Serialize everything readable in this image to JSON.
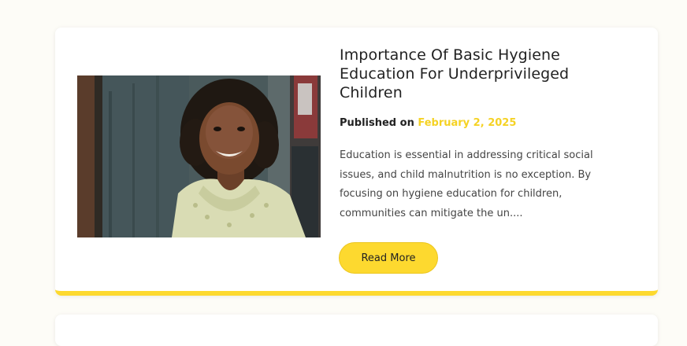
{
  "post": {
    "title": "Importance Of Basic Hygiene Education For Underprivileged Children",
    "published_label": "Published on",
    "published_date": "February 2, 2025",
    "excerpt": "Education is essential in addressing critical social issues, and child malnutrition is no exception. By focusing on hygiene education for children, communities can mitigate the un....",
    "read_more_label": "Read More"
  },
  "colors": {
    "accent": "#fdd92f",
    "date": "#f5d224",
    "page_background": "#fdfcf7"
  }
}
